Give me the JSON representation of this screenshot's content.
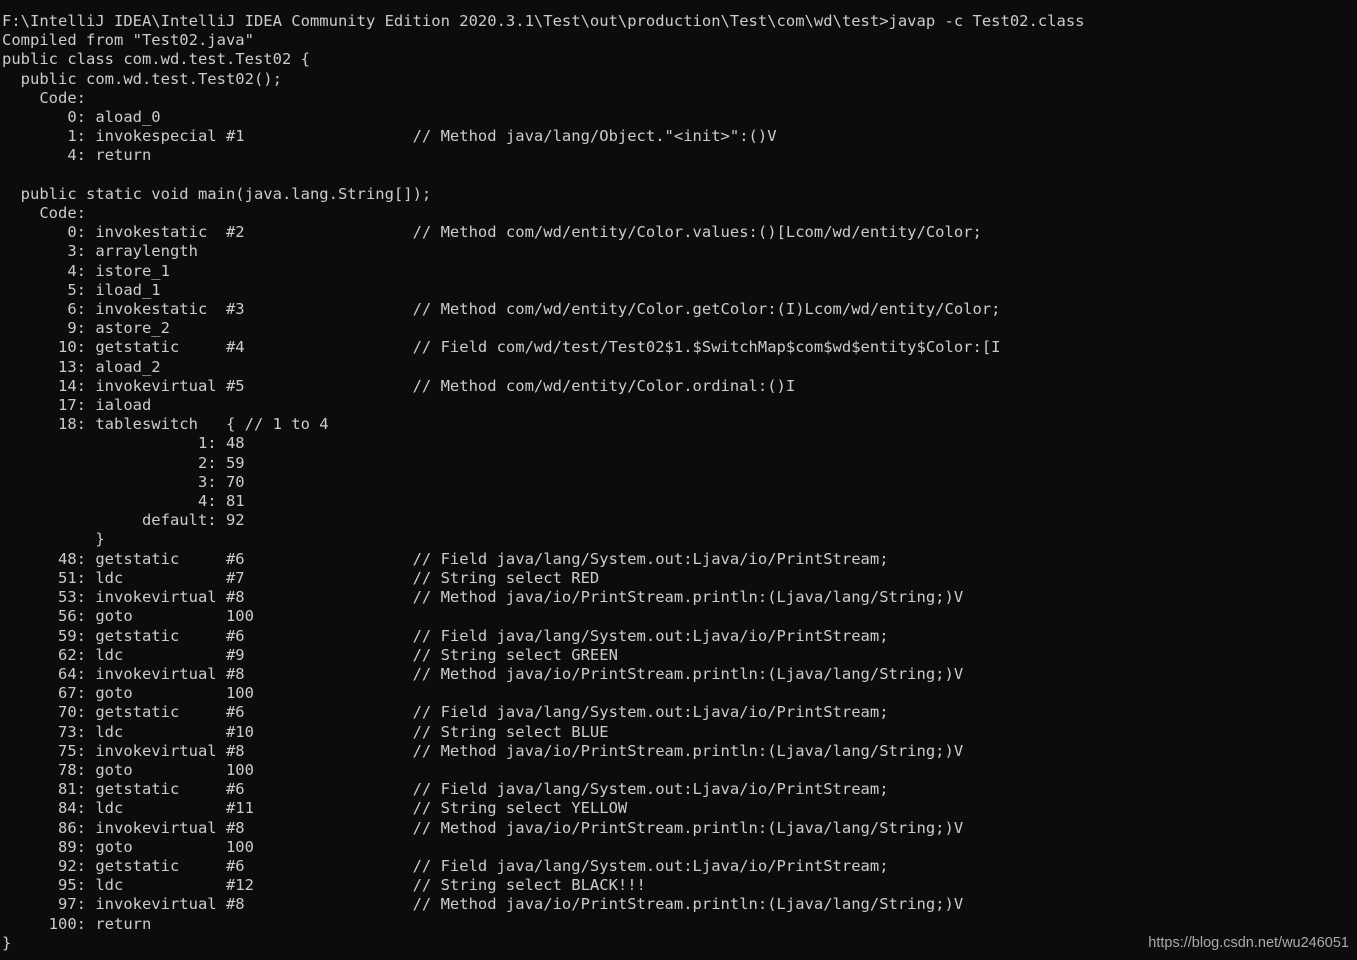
{
  "terminal": {
    "background_color": "#0c0c0c",
    "foreground_color": "#cccccc",
    "prompt_path": "F:\\IntelliJ IDEA\\IntelliJ IDEA Community Edition 2020.3.1\\Test\\out\\production\\Test\\com\\wd\\test",
    "prompt_symbol": ">",
    "command": "javap -c Test02.class",
    "output_text": "F:\\IntelliJ IDEA\\IntelliJ IDEA Community Edition 2020.3.1\\Test\\out\\production\\Test\\com\\wd\\test>javap -c Test02.class\nCompiled from \"Test02.java\"\npublic class com.wd.test.Test02 {\n  public com.wd.test.Test02();\n    Code:\n       0: aload_0\n       1: invokespecial #1                  // Method java/lang/Object.\"<init>\":()V\n       4: return\n\n  public static void main(java.lang.String[]);\n    Code:\n       0: invokestatic  #2                  // Method com/wd/entity/Color.values:()[Lcom/wd/entity/Color;\n       3: arraylength\n       4: istore_1\n       5: iload_1\n       6: invokestatic  #3                  // Method com/wd/entity/Color.getColor:(I)Lcom/wd/entity/Color;\n       9: astore_2\n      10: getstatic     #4                  // Field com/wd/test/Test02$1.$SwitchMap$com$wd$entity$Color:[I\n      13: aload_2\n      14: invokevirtual #5                  // Method com/wd/entity/Color.ordinal:()I\n      17: iaload\n      18: tableswitch   { // 1 to 4\n                     1: 48\n                     2: 59\n                     3: 70\n                     4: 81\n               default: 92\n          }\n      48: getstatic     #6                  // Field java/lang/System.out:Ljava/io/PrintStream;\n      51: ldc           #7                  // String select RED\n      53: invokevirtual #8                  // Method java/io/PrintStream.println:(Ljava/lang/String;)V\n      56: goto          100\n      59: getstatic     #6                  // Field java/lang/System.out:Ljava/io/PrintStream;\n      62: ldc           #9                  // String select GREEN\n      64: invokevirtual #8                  // Method java/io/PrintStream.println:(Ljava/lang/String;)V\n      67: goto          100\n      70: getstatic     #6                  // Field java/lang/System.out:Ljava/io/PrintStream;\n      73: ldc           #10                 // String select BLUE\n      75: invokevirtual #8                  // Method java/io/PrintStream.println:(Ljava/lang/String;)V\n      78: goto          100\n      81: getstatic     #6                  // Field java/lang/System.out:Ljava/io/PrintStream;\n      84: ldc           #11                 // String select YELLOW\n      86: invokevirtual #8                  // Method java/io/PrintStream.println:(Ljava/lang/String;)V\n      89: goto          100\n      92: getstatic     #6                  // Field java/lang/System.out:Ljava/io/PrintStream;\n      95: ldc           #12                 // String select BLACK!!!\n      97: invokevirtual #8                  // Method java/io/PrintStream.println:(Ljava/lang/String;)V\n     100: return\n}",
    "compiled_from": "Compiled from \"Test02.java\"",
    "class_declaration": "public class com.wd.test.Test02 {",
    "constructor_declaration": "public com.wd.test.Test02();",
    "main_declaration": "public static void main(java.lang.String[]);",
    "code_label": "Code:",
    "closing_brace": "}",
    "constant_pool_refs": [
      "#1",
      "#2",
      "#3",
      "#4",
      "#5",
      "#6",
      "#7",
      "#8",
      "#9",
      "#10",
      "#11",
      "#12"
    ],
    "constructor_instructions": [
      {
        "offset": "0",
        "mnemonic": "aload_0",
        "operand": "",
        "comment": ""
      },
      {
        "offset": "1",
        "mnemonic": "invokespecial",
        "operand": "#1",
        "comment": "// Method java/lang/Object.\"<init>\":()V"
      },
      {
        "offset": "4",
        "mnemonic": "return",
        "operand": "",
        "comment": ""
      }
    ],
    "main_instructions": [
      {
        "offset": "0",
        "mnemonic": "invokestatic",
        "operand": "#2",
        "comment": "// Method com/wd/entity/Color.values:()[Lcom/wd/entity/Color;"
      },
      {
        "offset": "3",
        "mnemonic": "arraylength",
        "operand": "",
        "comment": ""
      },
      {
        "offset": "4",
        "mnemonic": "istore_1",
        "operand": "",
        "comment": ""
      },
      {
        "offset": "5",
        "mnemonic": "iload_1",
        "operand": "",
        "comment": ""
      },
      {
        "offset": "6",
        "mnemonic": "invokestatic",
        "operand": "#3",
        "comment": "// Method com/wd/entity/Color.getColor:(I)Lcom/wd/entity/Color;"
      },
      {
        "offset": "9",
        "mnemonic": "astore_2",
        "operand": "",
        "comment": ""
      },
      {
        "offset": "10",
        "mnemonic": "getstatic",
        "operand": "#4",
        "comment": "// Field com/wd/test/Test02$1.$SwitchMap$com$wd$entity$Color:[I"
      },
      {
        "offset": "13",
        "mnemonic": "aload_2",
        "operand": "",
        "comment": ""
      },
      {
        "offset": "14",
        "mnemonic": "invokevirtual",
        "operand": "#5",
        "comment": "// Method com/wd/entity/Color.ordinal:()I"
      },
      {
        "offset": "17",
        "mnemonic": "iaload",
        "operand": "",
        "comment": ""
      },
      {
        "offset": "18",
        "mnemonic": "tableswitch",
        "operand": "{ // 1 to 4",
        "comment": ""
      },
      {
        "offset": "48",
        "mnemonic": "getstatic",
        "operand": "#6",
        "comment": "// Field java/lang/System.out:Ljava/io/PrintStream;"
      },
      {
        "offset": "51",
        "mnemonic": "ldc",
        "operand": "#7",
        "comment": "// String select RED"
      },
      {
        "offset": "53",
        "mnemonic": "invokevirtual",
        "operand": "#8",
        "comment": "// Method java/io/PrintStream.println:(Ljava/lang/String;)V"
      },
      {
        "offset": "56",
        "mnemonic": "goto",
        "operand": "100",
        "comment": ""
      },
      {
        "offset": "59",
        "mnemonic": "getstatic",
        "operand": "#6",
        "comment": "// Field java/lang/System.out:Ljava/io/PrintStream;"
      },
      {
        "offset": "62",
        "mnemonic": "ldc",
        "operand": "#9",
        "comment": "// String select GREEN"
      },
      {
        "offset": "64",
        "mnemonic": "invokevirtual",
        "operand": "#8",
        "comment": "// Method java/io/PrintStream.println:(Ljava/lang/String;)V"
      },
      {
        "offset": "67",
        "mnemonic": "goto",
        "operand": "100",
        "comment": ""
      },
      {
        "offset": "70",
        "mnemonic": "getstatic",
        "operand": "#6",
        "comment": "// Field java/lang/System.out:Ljava/io/PrintStream;"
      },
      {
        "offset": "73",
        "mnemonic": "ldc",
        "operand": "#10",
        "comment": "// String select BLUE"
      },
      {
        "offset": "75",
        "mnemonic": "invokevirtual",
        "operand": "#8",
        "comment": "// Method java/io/PrintStream.println:(Ljava/lang/String;)V"
      },
      {
        "offset": "78",
        "mnemonic": "goto",
        "operand": "100",
        "comment": ""
      },
      {
        "offset": "81",
        "mnemonic": "getstatic",
        "operand": "#6",
        "comment": "// Field java/lang/System.out:Ljava/io/PrintStream;"
      },
      {
        "offset": "84",
        "mnemonic": "ldc",
        "operand": "#11",
        "comment": "// String select YELLOW"
      },
      {
        "offset": "86",
        "mnemonic": "invokevirtual",
        "operand": "#8",
        "comment": "// Method java/io/PrintStream.println:(Ljava/lang/String;)V"
      },
      {
        "offset": "89",
        "mnemonic": "goto",
        "operand": "100",
        "comment": ""
      },
      {
        "offset": "92",
        "mnemonic": "getstatic",
        "operand": "#6",
        "comment": "// Field java/lang/System.out:Ljava/io/PrintStream;"
      },
      {
        "offset": "95",
        "mnemonic": "ldc",
        "operand": "#12",
        "comment": "// String select BLACK!!!"
      },
      {
        "offset": "97",
        "mnemonic": "invokevirtual",
        "operand": "#8",
        "comment": "// Method java/io/PrintStream.println:(Ljava/lang/String;)V"
      },
      {
        "offset": "100",
        "mnemonic": "return",
        "operand": "",
        "comment": ""
      }
    ],
    "tableswitch": {
      "header": "tableswitch   { // 1 to 4",
      "range_low": 1,
      "range_high": 4,
      "cases": [
        {
          "key": "1",
          "target": "48"
        },
        {
          "key": "2",
          "target": "59"
        },
        {
          "key": "3",
          "target": "70"
        },
        {
          "key": "4",
          "target": "81"
        }
      ],
      "default_label": "default",
      "default_target": "92",
      "closing_brace": "}"
    }
  },
  "watermark": {
    "text": "https://blog.csdn.net/wu246051"
  }
}
